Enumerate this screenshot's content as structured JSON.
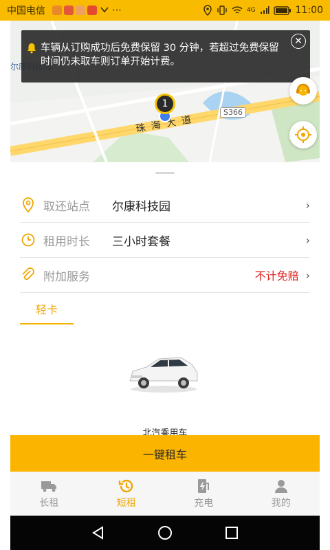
{
  "status_bar": {
    "carrier": "中国电信",
    "extra": "⋯",
    "time": "11:00",
    "network": "4G",
    "colors": {
      "background": "#f9bb00"
    }
  },
  "map": {
    "notice_text": "车辆从订购成功后免费保留 30 分钟，若超过免费保留时间仍未取车则订单开始计费。",
    "close_icon": "close-icon",
    "poi_label": "尔康科技园",
    "road_badge": "S366",
    "road_name": "珠 海 大 道",
    "pin_count": "1"
  },
  "rental_form": {
    "rows": [
      {
        "label": "取还站点",
        "value": "尔康科技园",
        "icon": "location-pin-icon"
      },
      {
        "label": "租用时长",
        "value": "三小时套餐",
        "icon": "clock-icon"
      },
      {
        "label": "附加服务",
        "value": "",
        "extra": "不计免赔",
        "icon": "paperclip-icon"
      }
    ],
    "chevron": "›"
  },
  "vehicle_tabs": [
    {
      "label": "轻卡",
      "active": true
    }
  ],
  "vehicle": {
    "name": "北汽乘用车"
  },
  "rent_button": "一键租车",
  "bottom_nav": [
    {
      "label": "长租",
      "icon": "truck-icon",
      "active": false
    },
    {
      "label": "短租",
      "icon": "history-clock-icon",
      "active": true
    },
    {
      "label": "充电",
      "icon": "charging-icon",
      "active": false
    },
    {
      "label": "我的",
      "icon": "user-icon",
      "active": false
    }
  ],
  "colors": {
    "accent": "#fbb400",
    "active_text": "#f0a500",
    "warning_text": "#e0221c"
  }
}
